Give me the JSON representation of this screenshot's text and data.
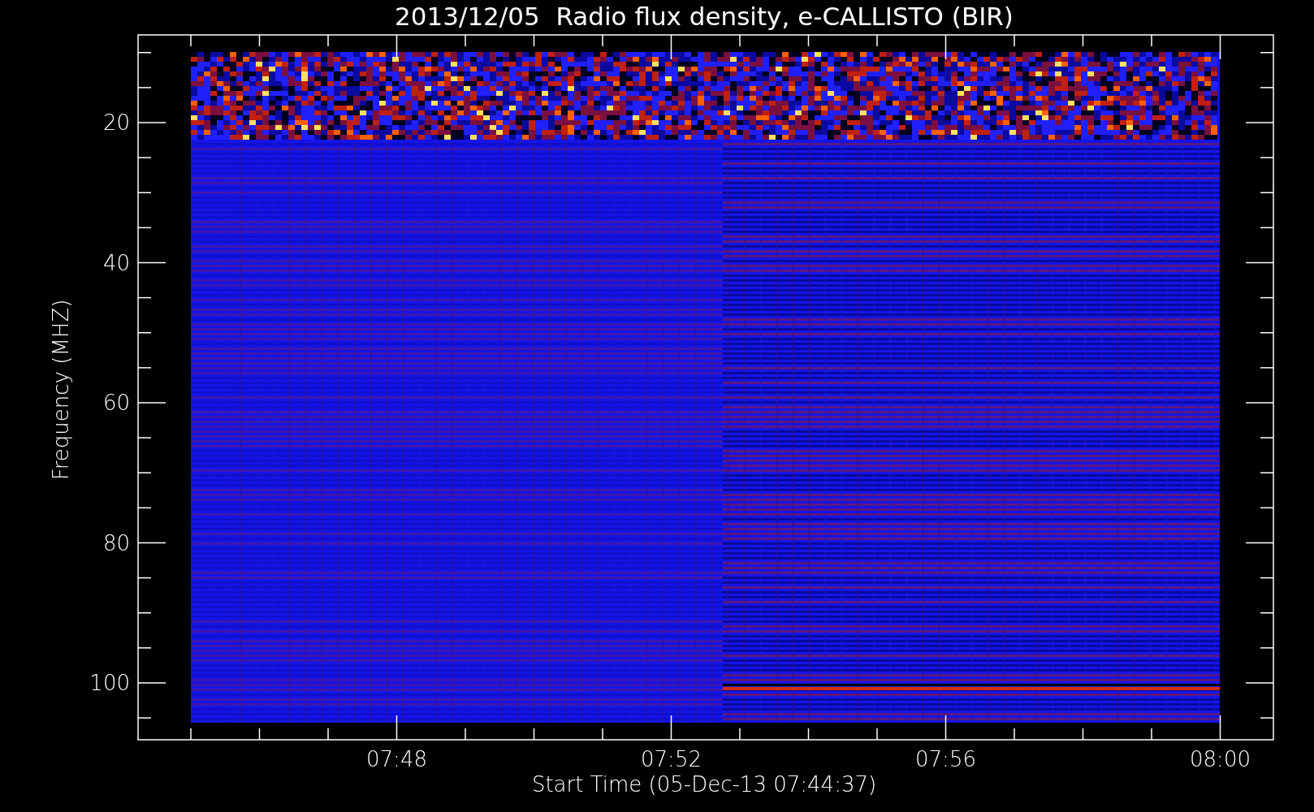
{
  "title": "2013/12/05  Radio flux density, e-CALLISTO (BIR)",
  "plot": {
    "ylabel": "Frequency (MHZ)",
    "yticks": [
      "20",
      "40",
      "60",
      "80",
      "100"
    ],
    "xticks": [
      "07:48",
      "07:52",
      "07:56",
      "08:00"
    ],
    "xlabel": "Start Time (05-Dec-13 07:44:37)"
  }
}
